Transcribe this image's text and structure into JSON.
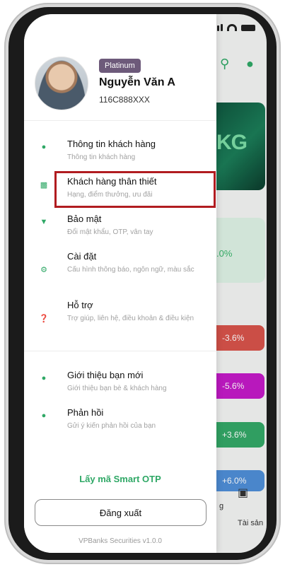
{
  "profile": {
    "tier": "Platinum",
    "name": "Nguyễn Văn A",
    "code": "116C888XXX"
  },
  "menu_group_1": [
    {
      "icon": "user-icon",
      "title": "Thông tin khách hàng",
      "subtitle": "Thông tin khách hàng"
    },
    {
      "icon": "gift-icon",
      "title": "Khách hàng thân thiết",
      "subtitle": "Hạng, điểm thưởng, ưu đãi"
    },
    {
      "icon": "shield-icon",
      "title": "Bảo mật",
      "subtitle": "Đổi mật khẩu, OTP, vân tay"
    },
    {
      "icon": "gear-icon",
      "title": "Cài đặt",
      "subtitle": "Cấu hình thông báo, ngôn ngữ, màu sắc"
    },
    {
      "icon": "help-icon",
      "title": "Hỗ trợ",
      "subtitle": "Trợ giúp, liên hệ, điều khoản & điều kiện"
    }
  ],
  "menu_group_2": [
    {
      "icon": "add-user-icon",
      "title": "Giới thiệu bạn mới",
      "subtitle": "Giới thiệu bạn bè & khách hàng"
    },
    {
      "icon": "chat-icon",
      "title": "Phản hồi",
      "subtitle": "Gửi ý kiến phản hồi của bạn"
    }
  ],
  "otp_link": "Lấy mã Smart OTP",
  "logout_label": "Đăng xuất",
  "version": "VPBanks Securities v1.0.0",
  "background": {
    "mint_value": ".0%",
    "changes": [
      {
        "value": "-3.6%",
        "color": "#d8534b"
      },
      {
        "value": "-5.6%",
        "color": "#c41ac8"
      },
      {
        "value": "+3.6%",
        "color": "#34a868"
      },
      {
        "value": "+6.0%",
        "color": "#4f8fd8"
      }
    ],
    "tab_partial": "g",
    "tab_assets": "Tài sản"
  },
  "colors": {
    "accent": "#2fa866",
    "highlight": "#b11c20",
    "badge": "#6d5a7a"
  }
}
